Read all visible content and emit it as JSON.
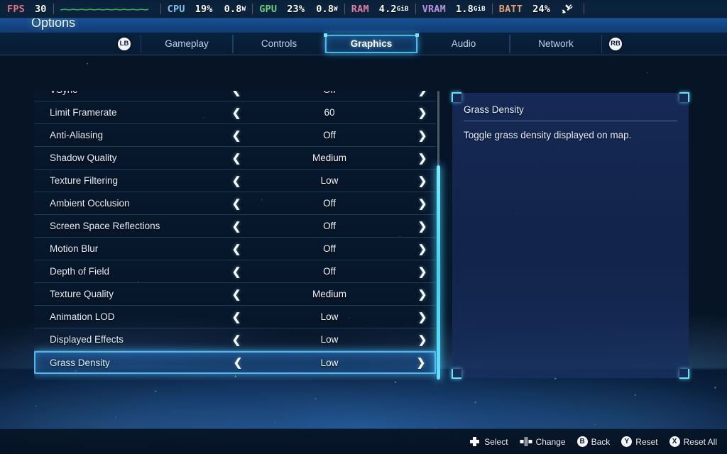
{
  "perf_overlay": {
    "items": [
      {
        "label": "FPS",
        "color": "#e8707f",
        "value": "30",
        "unit": ""
      },
      {
        "label": "CPU",
        "color": "#7fc4e8",
        "value": "19%",
        "unit": ""
      },
      {
        "label": "",
        "color": "#7fc4e8",
        "value": "0.8",
        "unit": "W"
      },
      {
        "label": "GPU",
        "color": "#6fcf7f",
        "value": "23%",
        "unit": ""
      },
      {
        "label": "",
        "color": "#6fcf7f",
        "value": "0.8",
        "unit": "W"
      },
      {
        "label": "RAM",
        "color": "#e07f9e",
        "value": "4.2",
        "unit": "GiB"
      },
      {
        "label": "VRAM",
        "color": "#b98fe0",
        "value": "1.8",
        "unit": "GiB"
      },
      {
        "label": "BATT",
        "color": "#e8a070",
        "value": "24%",
        "unit": ""
      }
    ],
    "graph_name": "frametime-graph",
    "graph_color": "#3fae56",
    "plug_icon": "power-plug-icon"
  },
  "header": {
    "title": "Options"
  },
  "tabbar": {
    "left_bumper": "LB",
    "right_bumper": "RB",
    "tabs": [
      {
        "label": "Gameplay",
        "active": false
      },
      {
        "label": "Controls",
        "active": false
      },
      {
        "label": "Graphics",
        "active": true
      },
      {
        "label": "Audio",
        "active": false
      },
      {
        "label": "Network",
        "active": false
      }
    ]
  },
  "settings_list": {
    "left_arrow": "❮",
    "right_arrow": "❯",
    "rows": [
      {
        "name": "VSync",
        "value": "Off",
        "selected": false
      },
      {
        "name": "Limit Framerate",
        "value": "60",
        "selected": false
      },
      {
        "name": "Anti-Aliasing",
        "value": "Off",
        "selected": false
      },
      {
        "name": "Shadow Quality",
        "value": "Medium",
        "selected": false
      },
      {
        "name": "Texture Filtering",
        "value": "Low",
        "selected": false
      },
      {
        "name": "Ambient Occlusion",
        "value": "Off",
        "selected": false
      },
      {
        "name": "Screen Space Reflections",
        "value": "Off",
        "selected": false
      },
      {
        "name": "Motion Blur",
        "value": "Off",
        "selected": false
      },
      {
        "name": "Depth of Field",
        "value": "Off",
        "selected": false
      },
      {
        "name": "Texture Quality",
        "value": "Medium",
        "selected": false
      },
      {
        "name": "Animation LOD",
        "value": "Low",
        "selected": false
      },
      {
        "name": "Displayed Effects",
        "value": "Low",
        "selected": false
      },
      {
        "name": "Grass Density",
        "value": "Low",
        "selected": true
      }
    ]
  },
  "info_panel": {
    "title": "Grass Density",
    "description": "Toggle grass density displayed on map."
  },
  "footer": {
    "hints": [
      {
        "icon": "dpad-icon",
        "label": "Select"
      },
      {
        "icon": "dpad-lr-icon",
        "label": "Change"
      },
      {
        "icon": "button-b-icon",
        "label": "Back",
        "button": "B"
      },
      {
        "icon": "button-y-icon",
        "label": "Reset",
        "button": "Y"
      },
      {
        "icon": "button-x-icon",
        "label": "Reset All",
        "button": "X"
      }
    ]
  },
  "accent_colors": {
    "selection_border": "#4fb6f0",
    "scrollbar_thumb": "#5fe0ff",
    "panel_corner": "#5fe3ff"
  }
}
